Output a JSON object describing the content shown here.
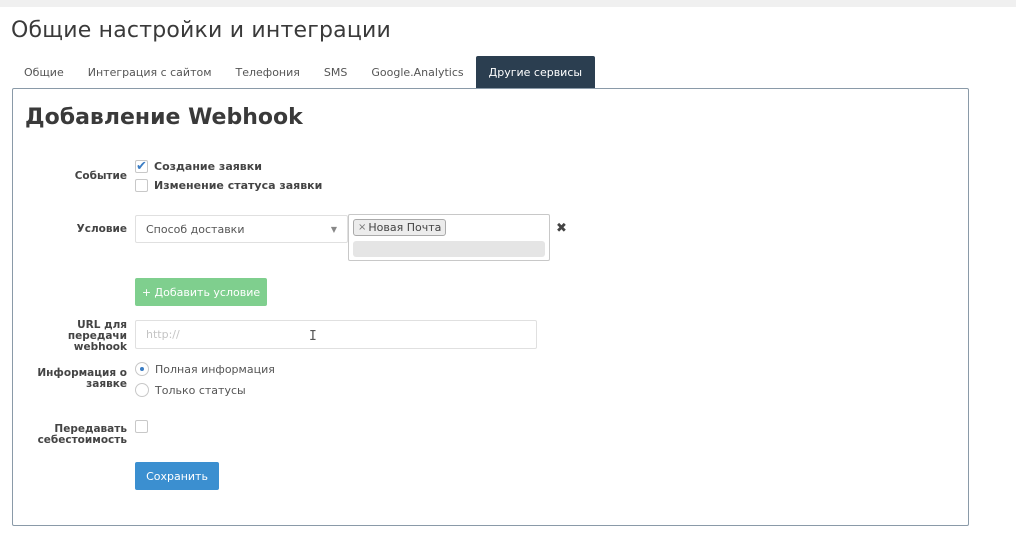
{
  "page": {
    "title": "Общие настройки и интеграции"
  },
  "tabs": [
    {
      "label": "Общие",
      "active": false
    },
    {
      "label": "Интеграция с сайтом",
      "active": false
    },
    {
      "label": "Телефония",
      "active": false
    },
    {
      "label": "SMS",
      "active": false
    },
    {
      "label": "Google.Analytics",
      "active": false
    },
    {
      "label": "Другие сервисы",
      "active": true
    }
  ],
  "form": {
    "title": "Добавление Webhook",
    "event": {
      "label": "Событие",
      "options": [
        {
          "label": "Создание заявки",
          "checked": true
        },
        {
          "label": "Изменение статуса заявки",
          "checked": false
        }
      ]
    },
    "condition": {
      "label": "Условие",
      "select_value": "Способ доставки",
      "tags": [
        {
          "remove": "×",
          "label": "Новая Почта"
        }
      ],
      "remove_symbol": "✖"
    },
    "add_condition_label": "+ Добавить условие",
    "url": {
      "label_line1": "URL для",
      "label_line2": "передачи",
      "label_line3": "webhook",
      "placeholder": "http://",
      "value": ""
    },
    "info": {
      "label_line1": "Информация о",
      "label_line2": "заявке",
      "options": [
        {
          "label": "Полная информация",
          "checked": true
        },
        {
          "label": "Только статусы",
          "checked": false
        }
      ]
    },
    "cost": {
      "label_line1": "Передавать",
      "label_line2": "себестоимость",
      "checked": false
    },
    "save_label": "Сохранить"
  },
  "colors": {
    "active_tab": "#2b3e50",
    "add_button": "#7fcf8e",
    "save_button": "#3b8fd0",
    "accent": "#3b7dc4"
  }
}
